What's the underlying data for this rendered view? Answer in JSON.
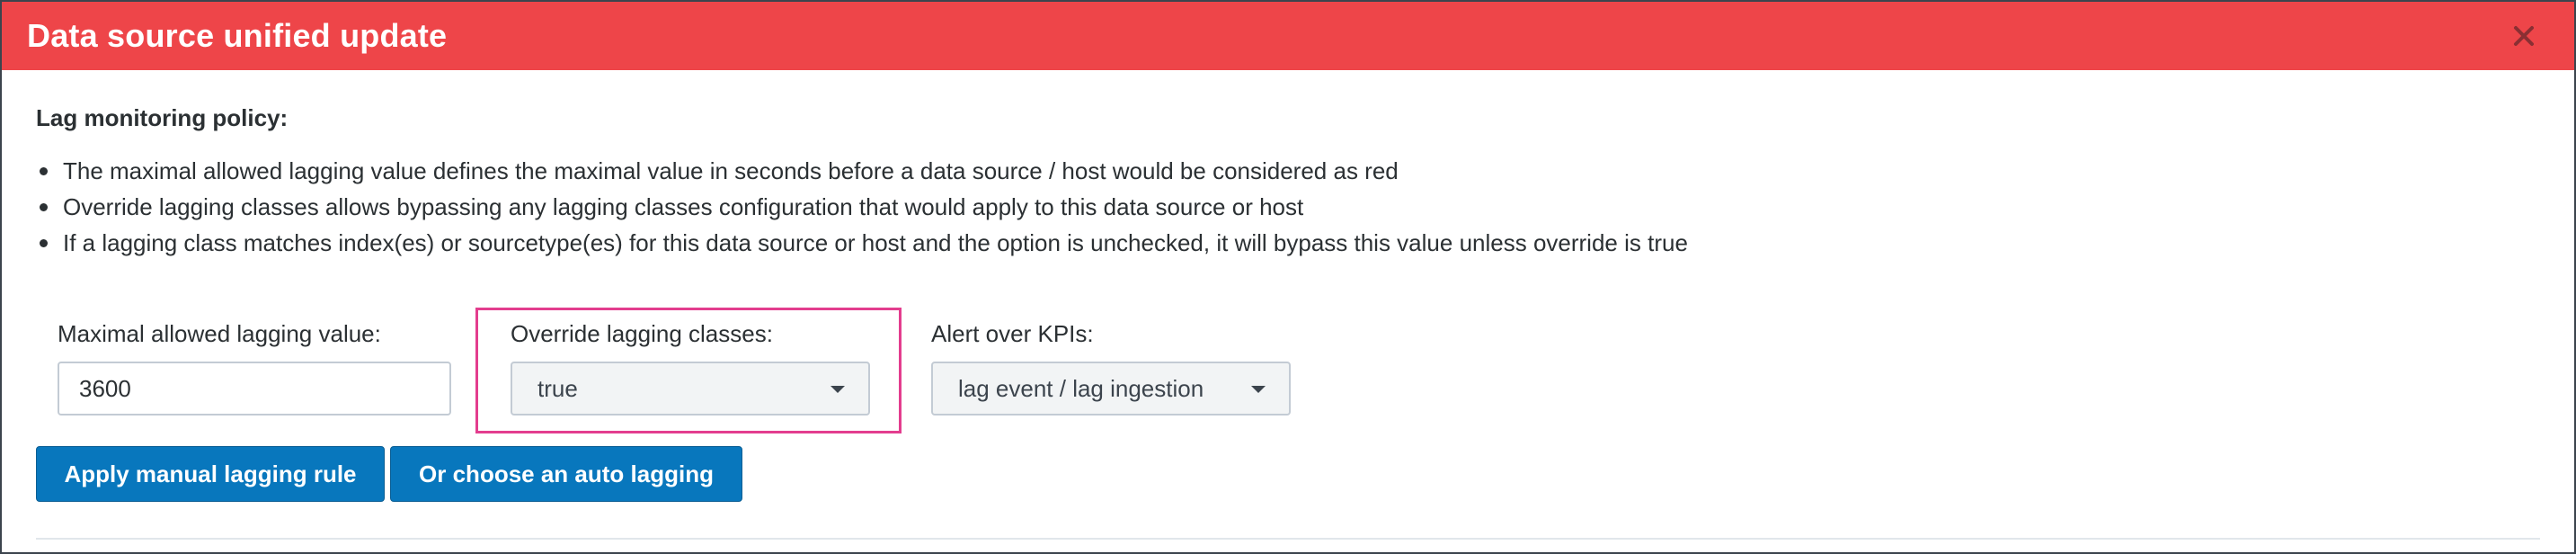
{
  "dialog": {
    "title": "Data source unified update",
    "close_icon": "close-icon"
  },
  "policy": {
    "title": "Lag monitoring policy:",
    "bullets": [
      "The maximal allowed lagging value defines the maximal value in seconds before a data source / host would be considered as red",
      "Override lagging classes allows bypassing any lagging classes configuration that would apply to this data source or host",
      "If a lagging class matches index(es) or sourcetype(es) for this data source or host and the option is unchecked, it will bypass this value unless override is true"
    ]
  },
  "form": {
    "max_lag": {
      "label": "Maximal allowed lagging value:",
      "value": "3600"
    },
    "override": {
      "label": "Override lagging classes:",
      "selected": "true"
    },
    "alert_kpis": {
      "label": "Alert over KPIs:",
      "selected": "lag event / lag ingestion"
    }
  },
  "buttons": {
    "apply_manual": "Apply manual lagging rule",
    "auto_lagging": "Or choose an auto lagging"
  },
  "colors": {
    "header_bg": "#ee4549",
    "primary_button": "#0877bd",
    "highlight_border": "#e33d8e"
  }
}
